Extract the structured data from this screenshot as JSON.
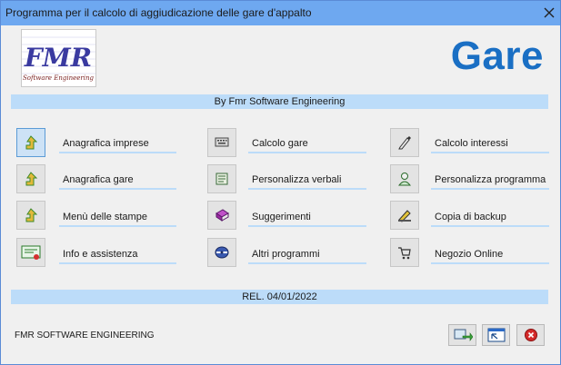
{
  "window": {
    "title": "Programma per il calcolo di aggiudicazione delle gare d'appalto"
  },
  "logo": {
    "letters": "FMR",
    "caption": "Software Engineering"
  },
  "header": {
    "app_title": "Gare",
    "byline": "By Fmr Software Engineering"
  },
  "menu": {
    "col1": [
      {
        "label": "Anagrafica imprese",
        "icon": "arrow-up-icon"
      },
      {
        "label": "Anagrafica gare",
        "icon": "arrow-up-icon"
      },
      {
        "label": "Menù delle stampe",
        "icon": "arrow-up-icon"
      },
      {
        "label": "Info e assistenza",
        "icon": "info-monitor-icon"
      }
    ],
    "col2": [
      {
        "label": "Calcolo gare",
        "icon": "keyboard-icon"
      },
      {
        "label": "Personalizza verbali",
        "icon": "document-icon"
      },
      {
        "label": "Suggerimenti",
        "icon": "book-icon"
      },
      {
        "label": "Altri programmi",
        "icon": "disk-icon"
      }
    ],
    "col3": [
      {
        "label": "Calcolo interessi",
        "icon": "pen-icon"
      },
      {
        "label": "Personalizza programma",
        "icon": "user-icon"
      },
      {
        "label": "Copia di backup",
        "icon": "backup-icon"
      },
      {
        "label": "Negozio Online",
        "icon": "cart-icon"
      }
    ]
  },
  "release": "REL. 04/01/2022",
  "footer": {
    "company": "FMR SOFTWARE ENGINEERING"
  },
  "colors": {
    "titlebar": "#6ea8f0",
    "accent": "#1a6fc4",
    "band": "#bcdcf9"
  }
}
